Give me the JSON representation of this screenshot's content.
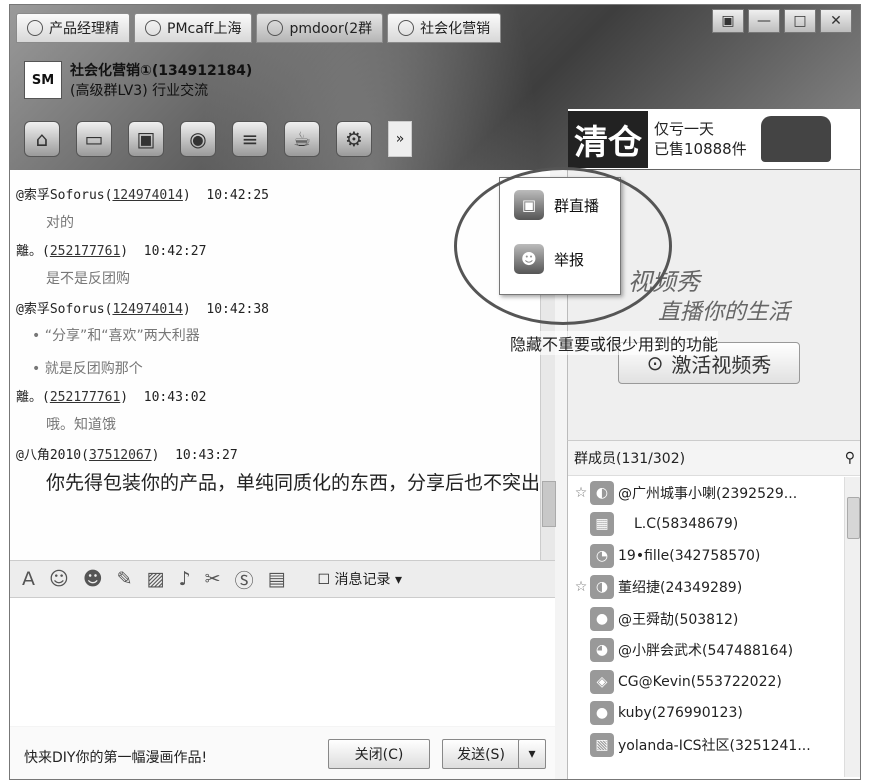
{
  "tabs": [
    {
      "label": "产品经理精"
    },
    {
      "label": "PMcaff上海"
    },
    {
      "label": "pmdoor(2群"
    },
    {
      "label": "社会化营销"
    }
  ],
  "window_controls": {
    "menu": "▣",
    "minimize": "—",
    "maximize": "□",
    "close": "✕"
  },
  "group": {
    "logo_text": "SM",
    "name": "社会化营销①(134912184)",
    "subtitle": "(高级群LV3) 行业交流"
  },
  "toolbar": {
    "more": "»"
  },
  "ad": {
    "big": "清仓",
    "line1": "仅亏一天",
    "line2": "已售10888件"
  },
  "messages": [
    {
      "sender": "@索孚Soforus",
      "qq": "124974014",
      "time": "10:42:25",
      "text": "对的"
    },
    {
      "sender": "離。",
      "qq": "252177761",
      "time": "10:42:27",
      "text": "是不是反团购"
    },
    {
      "sender": "@索孚Soforus",
      "qq": "124974014",
      "time": "10:42:38",
      "text": "• “分享”和“喜欢”两大利器",
      "text2": "• 就是反团购那个"
    },
    {
      "sender": "離。",
      "qq": "252177761",
      "time": "10:43:02",
      "text": "哦。知道饿"
    },
    {
      "sender": "@八角2010",
      "qq": "37512067",
      "time": "10:43:27",
      "text": "你先得包装你的产品，单纯同质化的东西，分享后也不突出"
    }
  ],
  "input_toolbar": {
    "history": "消息记录"
  },
  "bottom": {
    "tip": "快来DIY你的第一幅漫画作品!",
    "close_btn": "关闭(C)",
    "send_btn": "发送(S)"
  },
  "popup": {
    "item1": "群直播",
    "item2": "举报"
  },
  "annotation": "隐藏不重要或很少用到的功能",
  "video_show": {
    "line1": "视频秀",
    "line2": "直播你的生活",
    "button": "激活视频秀"
  },
  "members": {
    "title": "群成员(131/302)",
    "list": [
      {
        "name": "@广州城事小喇(2392529...",
        "star": true
      },
      {
        "name": "L.C(58348679)",
        "star": false
      },
      {
        "name": "19•fille(342758570)",
        "star": false
      },
      {
        "name": "董绍捷(24349289)",
        "star": true
      },
      {
        "name": "@王舜劼(503812)",
        "star": false
      },
      {
        "name": "@小胖会武术(547488164)",
        "star": false
      },
      {
        "name": "CG@Kevin(553722022)",
        "star": false
      },
      {
        "name": "kuby(276990123)",
        "star": false
      },
      {
        "name": "yolanda-ICS社区(3251241...",
        "star": false
      }
    ]
  }
}
